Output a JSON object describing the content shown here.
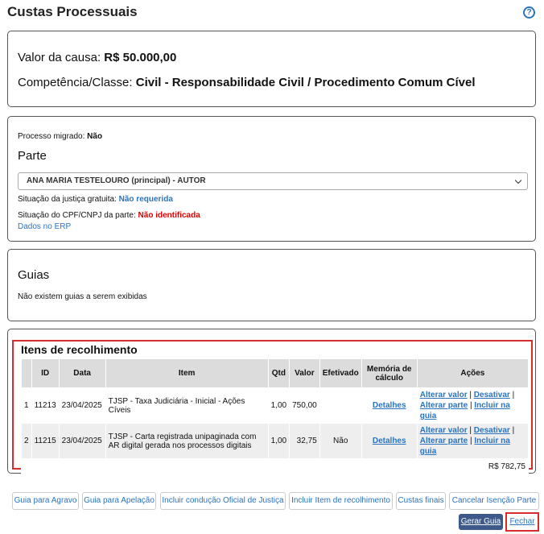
{
  "header": {
    "title": "Custas Processuais"
  },
  "causa": {
    "valor_label": "Valor da causa:",
    "valor": "R$ 50.000,00",
    "competencia_label": "Competência/Classe:",
    "competencia": "Civil - Responsabilidade Civil / Procedimento Comum Cível"
  },
  "parte": {
    "migrado_label": "Processo migrado:",
    "migrado": "Não",
    "heading": "Parte",
    "selected": "ANA MARIA TESTELOURO (principal) - AUTOR",
    "justica_label": "Situação da justiça gratuita:",
    "justica": "Não requerida",
    "cpf_label": "Situação do CPF/CNPJ da parte:",
    "cpf": "Não identificada",
    "erp_link": "Dados no ERP"
  },
  "guias": {
    "heading": "Guias",
    "empty": "Não existem guias a serem exibidas"
  },
  "itens": {
    "heading": "Itens de recolhimento",
    "columns": [
      "",
      "ID",
      "Data",
      "Item",
      "Qtd",
      "Valor",
      "Efetivado",
      "Memória de cálculo",
      "Ações"
    ],
    "rows": [
      {
        "n": "1",
        "id": "11213",
        "data": "23/04/2025",
        "item": "TJSP - Taxa Judiciária - Inicial - Ações Cíveis",
        "qtd": "1,00",
        "valor": "750,00",
        "efetivado": "",
        "memoria": "Detalhes",
        "a1": "Alterar valor",
        "a2": "Desativar",
        "a3": "Alterar parte",
        "a4": "Incluir na guia"
      },
      {
        "n": "2",
        "id": "11215",
        "data": "23/04/2025",
        "item": "TJSP - Carta registrada unipaginada com AR digital gerada nos processos digitais",
        "qtd": "1,00",
        "valor": "32,75",
        "efetivado": "Não",
        "memoria": "Detalhes",
        "a1": "Alterar valor",
        "a2": "Desativar",
        "a3": "Alterar parte",
        "a4": "Incluir na guia"
      }
    ],
    "total": "R$ 782,75"
  },
  "buttons": {
    "agravo": "Guia para Agravo",
    "apelacao": "Guia para Apelação",
    "oficial": "Incluir condução Oficial de Justiça",
    "item": "Incluir Item de recolhimento",
    "finais": "Custas finais",
    "isencao": "Cancelar Isenção Parte",
    "gerar": "Gerar Guia",
    "fechar": "Fechar"
  },
  "colors": {
    "accent": "#2a74c0",
    "alert": "#e00000",
    "highlight_border": "#d62c2c",
    "primary_button": "#3d5a8a"
  }
}
